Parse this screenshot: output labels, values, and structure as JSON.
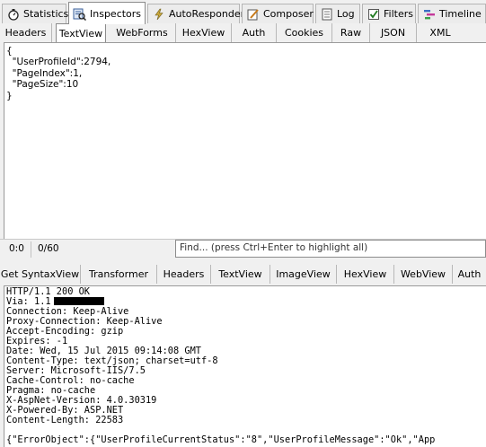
{
  "main_tabs": [
    {
      "label": "Statistics",
      "icon": "stopwatch-icon"
    },
    {
      "label": "Inspectors",
      "icon": "inspectors-icon",
      "active": true
    },
    {
      "label": "AutoResponder",
      "icon": "lightning-icon"
    },
    {
      "label": "Composer",
      "icon": "composer-icon"
    },
    {
      "label": "Log",
      "icon": "log-icon"
    },
    {
      "label": "Filters",
      "icon": "checkbox-icon"
    },
    {
      "label": "Timeline",
      "icon": "timeline-icon"
    }
  ],
  "request_tabs": [
    "Headers",
    "TextView",
    "WebForms",
    "HexView",
    "Auth",
    "Cookies",
    "Raw",
    "JSON",
    "XML"
  ],
  "request_active_tab": "TextView",
  "request_body": "{\n  \"UserProfileId\":2794,\n  \"PageIndex\":1,\n  \"PageSize\":10\n}",
  "status": {
    "position": "0:0",
    "count": "0/60"
  },
  "find_placeholder": "Find... (press Ctrl+Enter to highlight all)",
  "response_tabs": [
    "Get SyntaxView",
    "Transformer",
    "Headers",
    "TextView",
    "ImageView",
    "HexView",
    "WebView",
    "Auth"
  ],
  "response_headers": {
    "status_line": "HTTP/1.1 200 OK",
    "via_prefix": "Via: 1.1",
    "lines": [
      "Connection: Keep-Alive",
      "Proxy-Connection: Keep-Alive",
      "Accept-Encoding: gzip",
      "Expires: -1",
      "Date: Wed, 15 Jul 2015 09:14:08 GMT",
      "Content-Type: text/json; charset=utf-8",
      "Server: Microsoft-IIS/7.5",
      "Cache-Control: no-cache",
      "Pragma: no-cache",
      "X-AspNet-Version: 4.0.30319",
      "X-Powered-By: ASP.NET",
      "Content-Length: 22583"
    ],
    "body_line": "{\"ErrorObject\":{\"UserProfileCurrentStatus\":\"8\",\"UserProfileMessage\":\"Ok\",\"App"
  }
}
